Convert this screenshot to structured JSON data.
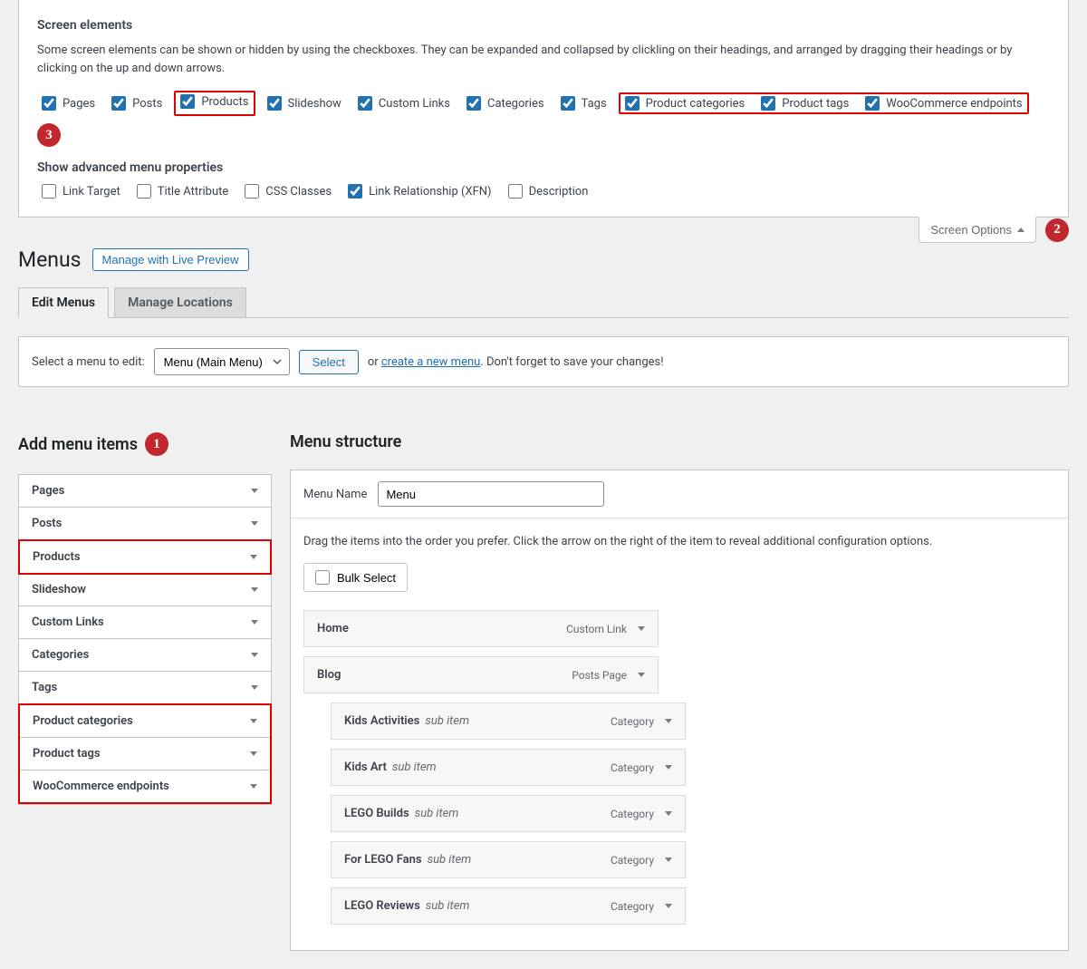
{
  "screen_options": {
    "heading1": "Screen elements",
    "description": "Some screen elements can be shown or hidden by using the checkboxes. They can be expanded and collapsed by clickling on their headings, and arranged by dragging their headings or by clicking on the up and down arrows.",
    "elements": [
      {
        "label": "Pages",
        "checked": true
      },
      {
        "label": "Posts",
        "checked": true
      },
      {
        "label": "Products",
        "checked": true,
        "highlight": true
      },
      {
        "label": "Slideshow",
        "checked": true
      },
      {
        "label": "Custom Links",
        "checked": true
      },
      {
        "label": "Categories",
        "checked": true
      },
      {
        "label": "Tags",
        "checked": true
      },
      {
        "label": "Product categories",
        "checked": true
      },
      {
        "label": "Product tags",
        "checked": true
      },
      {
        "label": "WooCommerce endpoints",
        "checked": true
      }
    ],
    "heading2": "Show advanced menu properties",
    "advanced": [
      {
        "label": "Link Target",
        "checked": false
      },
      {
        "label": "Title Attribute",
        "checked": false
      },
      {
        "label": "CSS Classes",
        "checked": false
      },
      {
        "label": "Link Relationship (XFN)",
        "checked": true
      },
      {
        "label": "Description",
        "checked": false
      }
    ],
    "toggle_label": "Screen Options"
  },
  "callouts": {
    "c1": "1",
    "c2": "2",
    "c3": "3"
  },
  "header": {
    "title": "Menus",
    "live_preview": "Manage with Live Preview"
  },
  "tabs": {
    "edit": "Edit Menus",
    "locations": "Manage Locations"
  },
  "selector": {
    "label": "Select a menu to edit:",
    "selected": "Menu (Main Menu)",
    "select_btn": "Select",
    "or": "or",
    "create_link": "create a new menu",
    "suffix": ". Don't forget to save your changes!"
  },
  "add_menu": {
    "title": "Add menu items",
    "items": [
      {
        "label": "Pages"
      },
      {
        "label": "Posts"
      },
      {
        "label": "Products"
      },
      {
        "label": "Slideshow"
      },
      {
        "label": "Custom Links"
      },
      {
        "label": "Categories"
      },
      {
        "label": "Tags"
      },
      {
        "label": "Product categories"
      },
      {
        "label": "Product tags"
      },
      {
        "label": "WooCommerce endpoints"
      }
    ]
  },
  "structure": {
    "title": "Menu structure",
    "name_label": "Menu Name",
    "name_value": "Menu",
    "instructions": "Drag the items into the order you prefer. Click the arrow on the right of the item to reveal additional configuration options.",
    "bulk_select": "Bulk Select",
    "sub_item_text": "sub item",
    "items": [
      {
        "label": "Home",
        "type": "Custom Link",
        "indent": false
      },
      {
        "label": "Blog",
        "type": "Posts Page",
        "indent": false
      },
      {
        "label": "Kids Activities",
        "type": "Category",
        "indent": true
      },
      {
        "label": "Kids Art",
        "type": "Category",
        "indent": true
      },
      {
        "label": "LEGO Builds",
        "type": "Category",
        "indent": true
      },
      {
        "label": "For LEGO Fans",
        "type": "Category",
        "indent": true
      },
      {
        "label": "LEGO Reviews",
        "type": "Category",
        "indent": true
      }
    ]
  }
}
